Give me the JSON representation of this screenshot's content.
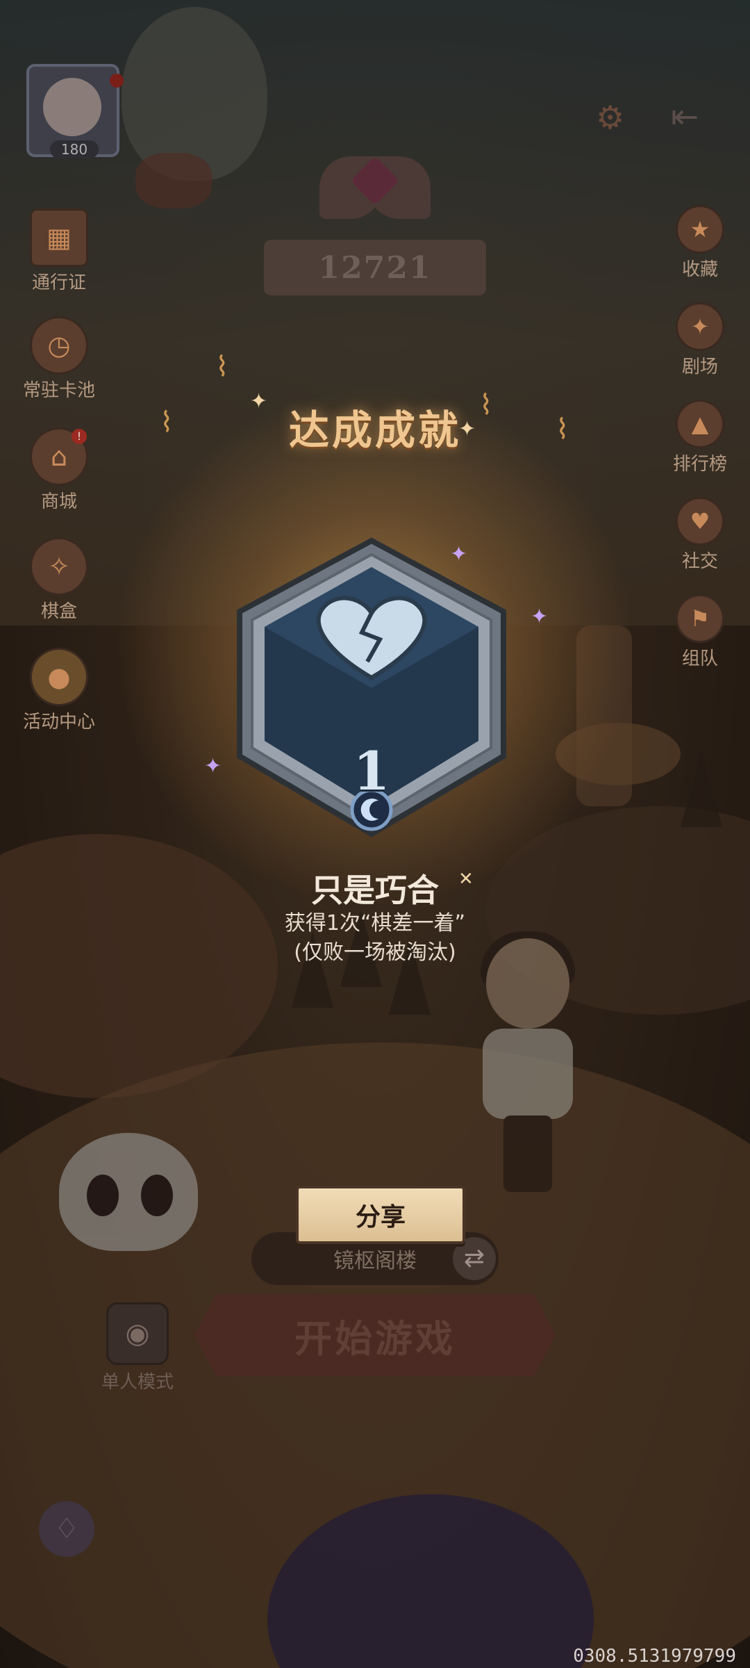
{
  "player": {
    "level": "180"
  },
  "rank": {
    "score": "12721"
  },
  "left_menu": [
    {
      "icon": "pass-icon",
      "label": "通行证"
    },
    {
      "icon": "clock-icon",
      "label": "常驻卡池"
    },
    {
      "icon": "shop-icon",
      "label": "商城"
    },
    {
      "icon": "chess-box-icon",
      "label": "棋盒"
    },
    {
      "icon": "balloon-icon",
      "label": "活动中心"
    }
  ],
  "right_menu": [
    {
      "icon": "star-icon",
      "label": "收藏"
    },
    {
      "icon": "theater-icon",
      "label": "剧场"
    },
    {
      "icon": "leaderboard-icon",
      "label": "排行榜"
    },
    {
      "icon": "social-icon",
      "label": "社交"
    },
    {
      "icon": "team-icon",
      "label": "组队"
    }
  ],
  "achievement": {
    "heading": "达成成就",
    "medal_number": "1",
    "name": "只是巧合",
    "description_line1": "获得1次“棋差一着”",
    "description_line2": "(仅败一场被淘汰)"
  },
  "controls": {
    "share": "分享",
    "mode": "镜枢阁楼",
    "start": "开始游戏",
    "solo_mode": "单人模式"
  },
  "footer": {
    "version": "0308.5131979799"
  },
  "colors": {
    "accent_gold": "#f0c690",
    "medal_blue": "#2a3f57",
    "medal_frame": "#8d98a4",
    "start_button": "#4b2a24"
  }
}
